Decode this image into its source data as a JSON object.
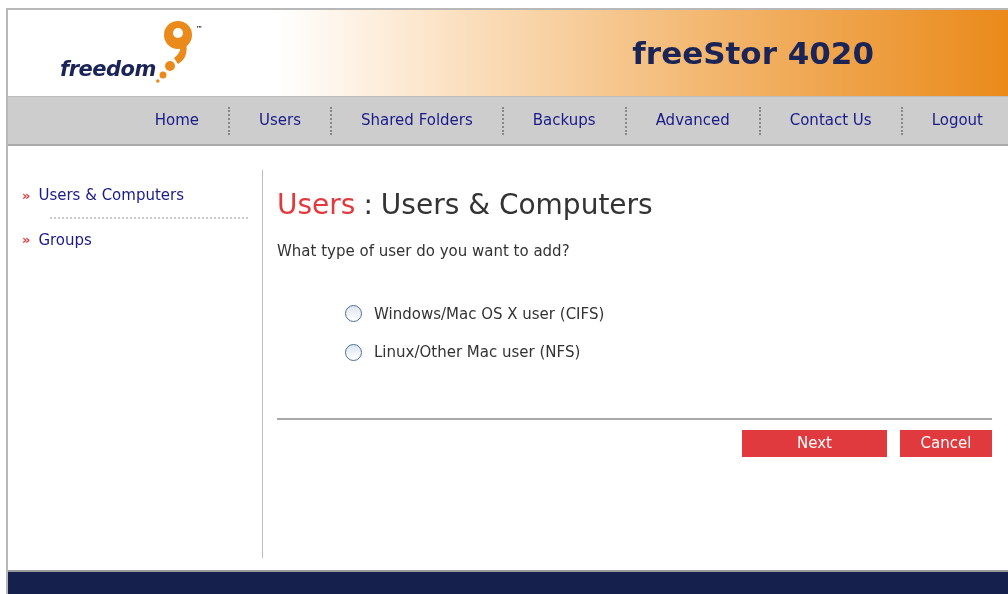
{
  "header": {
    "logo_text": "freedom",
    "logo_mark": "™",
    "product": "freeStor 4020"
  },
  "nav": [
    {
      "label": "Home"
    },
    {
      "label": "Users"
    },
    {
      "label": "Shared Folders"
    },
    {
      "label": "Backups"
    },
    {
      "label": "Advanced"
    },
    {
      "label": "Contact Us"
    },
    {
      "label": "Logout"
    }
  ],
  "sidebar": {
    "items": [
      {
        "bullet": "»",
        "label": "Users & Computers"
      },
      {
        "bullet": "»",
        "label": "Groups"
      }
    ]
  },
  "content": {
    "title_section": "Users",
    "title_separator": ":",
    "title_page": "Users & Computers",
    "question": "What type of user do you want to add?",
    "options": [
      {
        "label": "Windows/Mac OS X user (CIFS)",
        "selected": false
      },
      {
        "label": "Linux/Other Mac user (NFS)",
        "selected": false
      }
    ],
    "buttons": [
      "Next",
      "Cancel"
    ]
  }
}
